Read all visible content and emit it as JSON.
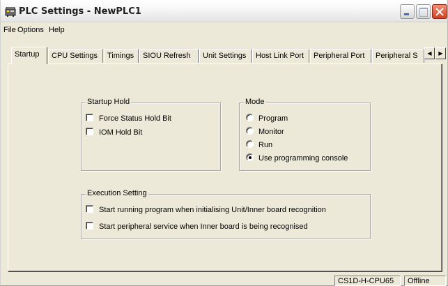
{
  "window": {
    "title": "PLC Settings - NewPLC1",
    "icon": "plc-app-icon"
  },
  "menu": {
    "items": [
      "File",
      "Options",
      "Help"
    ]
  },
  "tabs": [
    {
      "label": "Startup",
      "active": true
    },
    {
      "label": "CPU Settings",
      "active": false
    },
    {
      "label": "Timings",
      "active": false
    },
    {
      "label": "SIOU Refresh",
      "active": false
    },
    {
      "label": "Unit Settings",
      "active": false
    },
    {
      "label": "Host Link Port",
      "active": false
    },
    {
      "label": "Peripheral Port",
      "active": false
    },
    {
      "label": "Peripheral S",
      "active": false
    }
  ],
  "tab_scroll": {
    "left_icon": "scroll-left-icon",
    "right_icon": "scroll-right-icon"
  },
  "startup_hold": {
    "legend": "Startup Hold",
    "options": [
      {
        "label": "Force Status Hold Bit",
        "checked": false
      },
      {
        "label": "IOM Hold Bit",
        "checked": false
      }
    ]
  },
  "mode": {
    "legend": "Mode",
    "options": [
      {
        "label": "Program",
        "selected": false
      },
      {
        "label": "Monitor",
        "selected": false
      },
      {
        "label": "Run",
        "selected": false
      },
      {
        "label": "Use programming console",
        "selected": true
      }
    ]
  },
  "execution_setting": {
    "legend": "Execution Setting",
    "options": [
      {
        "label": "Start running program when initialising Unit/Inner board recognition",
        "checked": false
      },
      {
        "label": "Start peripheral service when Inner board is being recognised",
        "checked": false
      }
    ]
  },
  "status": {
    "model": "CS1D-H-CPU65",
    "connection": "Offline"
  }
}
